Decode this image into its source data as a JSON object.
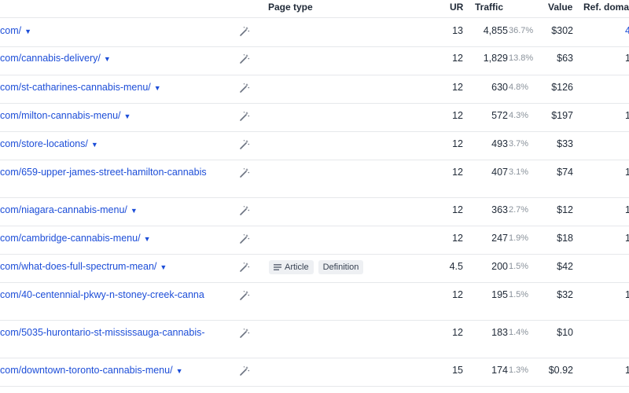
{
  "columns": {
    "page_type": "Page type",
    "ur": "UR",
    "traffic": "Traffic",
    "value": "Value",
    "ref_domains": "Ref. doma"
  },
  "dropdown_arrow": "▼",
  "rows": [
    {
      "url": "com/",
      "arrow": true,
      "ur": "13",
      "traffic": "4,855",
      "pct": "36.7%",
      "value": "$302",
      "ref": "4",
      "tags": []
    },
    {
      "url": "com/cannabis-delivery/",
      "arrow": true,
      "ur": "12",
      "traffic": "1,829",
      "pct": "13.8%",
      "value": "$63",
      "ref": "1",
      "tags": []
    },
    {
      "url": "com/st-catharines-cannabis-menu/",
      "arrow": true,
      "ur": "12",
      "traffic": "630",
      "pct": "4.8%",
      "value": "$126",
      "ref": "",
      "tags": []
    },
    {
      "url": "com/milton-cannabis-menu/",
      "arrow": true,
      "ur": "12",
      "traffic": "572",
      "pct": "4.3%",
      "value": "$197",
      "ref": "1",
      "tags": []
    },
    {
      "url": "com/store-locations/",
      "arrow": true,
      "ur": "12",
      "traffic": "493",
      "pct": "3.7%",
      "value": "$33",
      "ref": "",
      "tags": []
    },
    {
      "url": "com/659-upper-james-street-hamilton-cannabis",
      "arrow": false,
      "ur": "12",
      "traffic": "407",
      "pct": "3.1%",
      "value": "$74",
      "ref": "1",
      "tags": []
    },
    {
      "url": "com/niagara-cannabis-menu/",
      "arrow": true,
      "ur": "12",
      "traffic": "363",
      "pct": "2.7%",
      "value": "$12",
      "ref": "1",
      "tags": []
    },
    {
      "url": "com/cambridge-cannabis-menu/",
      "arrow": true,
      "ur": "12",
      "traffic": "247",
      "pct": "1.9%",
      "value": "$18",
      "ref": "1",
      "tags": []
    },
    {
      "url": "com/what-does-full-spectrum-mean/",
      "arrow": true,
      "ur": "4.5",
      "traffic": "200",
      "pct": "1.5%",
      "value": "$42",
      "ref": "",
      "tags": [
        "Article",
        "Definition"
      ]
    },
    {
      "url": "com/40-centennial-pkwy-n-stoney-creek-canna",
      "arrow": false,
      "ur": "12",
      "traffic": "195",
      "pct": "1.5%",
      "value": "$32",
      "ref": "1",
      "tags": []
    },
    {
      "url": "com/5035-hurontario-st-mississauga-cannabis-",
      "arrow": false,
      "ur": "12",
      "traffic": "183",
      "pct": "1.4%",
      "value": "$10",
      "ref": "",
      "tags": []
    },
    {
      "url": "com/downtown-toronto-cannabis-menu/",
      "arrow": true,
      "ur": "15",
      "traffic": "174",
      "pct": "1.3%",
      "value": "$0.92",
      "ref": "1",
      "tags": []
    }
  ]
}
